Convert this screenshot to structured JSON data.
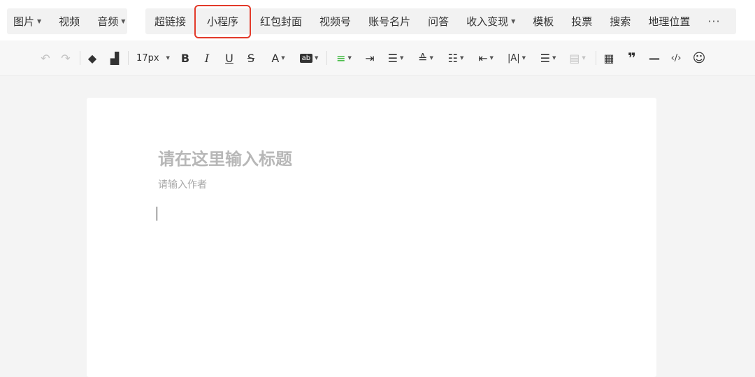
{
  "top_toolbar": {
    "left_group": [
      {
        "label": "图片",
        "has_dropdown": true
      },
      {
        "label": "视频",
        "has_dropdown": false
      },
      {
        "label": "音频",
        "has_dropdown": true
      }
    ],
    "right_group": [
      {
        "label": "超链接",
        "has_dropdown": false
      },
      {
        "label": "小程序",
        "has_dropdown": false,
        "highlighted": true
      },
      {
        "label": "红包封面",
        "has_dropdown": false
      },
      {
        "label": "视频号",
        "has_dropdown": false
      },
      {
        "label": "账号名片",
        "has_dropdown": false
      },
      {
        "label": "问答",
        "has_dropdown": false
      },
      {
        "label": "收入变现",
        "has_dropdown": true
      },
      {
        "label": "模板",
        "has_dropdown": false
      },
      {
        "label": "投票",
        "has_dropdown": false
      },
      {
        "label": "搜索",
        "has_dropdown": false
      },
      {
        "label": "地理位置",
        "has_dropdown": false
      }
    ],
    "more_label": "···",
    "highlight_color": "#e23a2a"
  },
  "format_toolbar": {
    "font_size": "17px",
    "icons": [
      "undo-icon",
      "redo-icon",
      "clear-format-icon",
      "format-painter-icon",
      "font-size-select",
      "bold-icon",
      "italic-icon",
      "underline-icon",
      "strikethrough-icon",
      "font-color-icon",
      "background-color-icon",
      "align-icon",
      "indent-icon",
      "paragraph-align-icon",
      "line-spacing-icon",
      "paragraph-spacing-icon",
      "text-indent-icon",
      "letter-spacing-icon",
      "list-icon",
      "disabled-format-icon",
      "table-icon",
      "quote-icon",
      "divider-icon",
      "code-icon",
      "emoji-icon"
    ],
    "accent_color": "#1aad19"
  },
  "editor": {
    "title_placeholder": "请在这里输入标题",
    "author_placeholder": "请输入作者"
  }
}
